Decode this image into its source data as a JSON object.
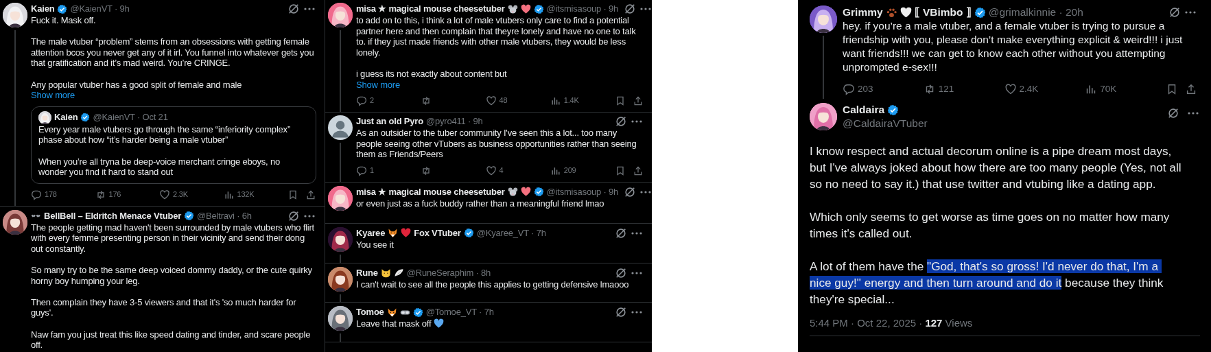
{
  "left_column": {
    "posts": [
      {
        "avatar": {
          "kind": "picture"
        },
        "name_parts": [
          {
            "kind": "text",
            "text": "Kaien"
          }
        ],
        "verified": true,
        "meta": "@KaienVT · 9h",
        "thread": true,
        "paragraphs": [
          "Fuck it. Mask off.",
          "The male vtuber “problem” stems from an obsessions with getting female attention bcos you never get any of it irl. You funnel into whatever gets you that gratification and it’s mad weird. You’re CRINGE.",
          "Any popular vtuber has a good split of female and male"
        ],
        "show_more": "Show more",
        "quote": {
          "avatar": {
            "kind": "picture"
          },
          "name": "Kaien",
          "verified": true,
          "meta": "@KaienVT · Oct 21",
          "paragraphs": [
            "Every year male vtubers go through the same “inferiority complex” phase about how “it’s harder being a male vtuber”",
            "When you’re all tryna be deep-voice merchant cringe eboys, no wonder you find it hard to stand out"
          ]
        },
        "stats": {
          "replies": "178",
          "reposts": "176",
          "likes": "2.3K",
          "views": "132K"
        }
      },
      {
        "avatar": {
          "kind": "picture"
        },
        "name_parts": [
          {
            "kind": "bats"
          },
          {
            "kind": "text",
            "text": "BellBell – Eldritch Menace Vtuber"
          }
        ],
        "verified": true,
        "meta": "@Beltravi · 6h",
        "thread": false,
        "paragraphs": [
          "The people getting mad haven't been surrounded by male vtubers who flirt with every femme presenting person in their vicinity and send their dong out constantly.",
          "So many try to be the same deep voiced dommy daddy, or the cute quirky horny boy humping your leg.",
          "Then complain they have 3-5 viewers and that it's 'so much harder for guys'.",
          "Naw fam you just treat this like speed dating and tinder, and scare people off."
        ]
      }
    ]
  },
  "middle_column": {
    "posts": [
      {
        "avatar": {
          "kind": "picture"
        },
        "name_parts": [
          {
            "kind": "text",
            "text": "misa ★ magical mouse cheesetuber"
          },
          {
            "kind": "mouse"
          },
          {
            "kind": "heart",
            "color": "#f4707f"
          }
        ],
        "verified": true,
        "meta": "@itsmisasoup · 9h",
        "thread": true,
        "paragraphs": [
          "to add on to this, i think a lot of male vtubers only care to find a potential partner here and then complain that theyre lonely and have no one to talk to. if they just made friends with other male vtubers, they would be less lonely.",
          "i guess its not exactly about content but"
        ],
        "show_more": "Show more",
        "stats": {
          "replies": "2",
          "likes": "48",
          "views": "1.4K"
        }
      },
      {
        "avatar": {
          "kind": "default"
        },
        "name_parts": [
          {
            "kind": "text",
            "text": "Just an old Pyro"
          }
        ],
        "verified": false,
        "meta": "@pyro411 · 9h",
        "thread": true,
        "paragraphs": [
          "As an outsider to the tuber community I've seen this a lot... too many people seeing other vTubers as business opportunities rather than seeing them as Friends/Peers"
        ],
        "stats": {
          "replies": "1",
          "likes": "4",
          "views": "209"
        }
      },
      {
        "avatar": {
          "kind": "picture"
        },
        "name_parts": [
          {
            "kind": "text",
            "text": "misa ★ magical mouse cheesetuber"
          },
          {
            "kind": "mouse"
          },
          {
            "kind": "heart",
            "color": "#f4707f"
          }
        ],
        "verified": true,
        "meta": "@itsmisasoup · 9h",
        "thread": false,
        "paragraphs": [
          "or even just as a fuck buddy rather than a meaningful friend lmao"
        ]
      },
      {
        "avatar": {
          "kind": "picture"
        },
        "name_parts": [
          {
            "kind": "text",
            "text": "Kyaree"
          },
          {
            "kind": "fox"
          },
          {
            "kind": "heart",
            "color": "#e0243a"
          },
          {
            "kind": "text",
            "text": "Fox VTuber"
          }
        ],
        "verified": true,
        "meta": "@Kyaree_VT · 7h",
        "thread": true,
        "paragraphs": [
          "You see it"
        ]
      },
      {
        "avatar": {
          "kind": "picture"
        },
        "name_parts": [
          {
            "kind": "text",
            "text": "Rune"
          },
          {
            "kind": "cat"
          },
          {
            "kind": "wing"
          }
        ],
        "verified": false,
        "meta": "@RuneSeraphim · 8h",
        "thread": true,
        "paragraphs": [
          "I can't wait to see all the people this applies to getting defensive lmaooo"
        ]
      },
      {
        "avatar": {
          "kind": "picture"
        },
        "name_parts": [
          {
            "kind": "text",
            "text": "Tomoe"
          },
          {
            "kind": "fox"
          },
          {
            "kind": "goggles"
          }
        ],
        "verified": true,
        "meta": "@Tomoe_VT · 7h",
        "thread": true,
        "paragraphs": [
          {
            "parts": [
              {
                "kind": "text",
                "text": "Leave that mask off"
              },
              {
                "kind": "heart",
                "color": "#5aa8f0"
              }
            ]
          }
        ]
      }
    ]
  },
  "right_column": {
    "reply": {
      "avatar": {
        "kind": "picture"
      },
      "name_parts": [
        {
          "kind": "text",
          "text": "Grimmy"
        },
        {
          "kind": "paw"
        },
        {
          "kind": "heart",
          "color": "#f0f0f0"
        },
        {
          "kind": "text",
          "text": "⟦ VBimbo ⟧"
        }
      ],
      "verified": true,
      "meta": "@grimalkinnie · 20h",
      "thread": true,
      "paragraphs": [
        "hey. if you’re a male vtuber, and a female vtuber is trying to pursue a friendship with you, please don’t make everything explicit & weird!!! i just want friends!!! we can get to know each other without you attempting unprompted e-sex!!!"
      ],
      "stats": {
        "replies": "203",
        "reposts": "121",
        "likes": "2.4K",
        "views": "70K"
      }
    },
    "main_post": {
      "avatar": {
        "kind": "picture"
      },
      "name": "Caldaira",
      "verified": true,
      "handle": "@CaldairaVTuber",
      "paragraphs": [
        {
          "parts": [
            {
              "kind": "text",
              "text": "I know respect and actual decorum online is a pipe dream most days, but I've always joked about how there are too many people (Yes, not all so no need to say it.) that use twitter and vtubing like a dating app.",
              "highlighted": false
            }
          ]
        },
        {
          "parts": [
            {
              "kind": "text",
              "text": "Which only seems to get worse as time goes on no matter how many times it's called out.",
              "highlighted": false
            }
          ]
        },
        {
          "parts": [
            {
              "kind": "text",
              "text": "A lot of them have the ",
              "highlighted": false
            },
            {
              "kind": "text",
              "text": "\"God, that's so gross! I'd never do that, I'm a nice guy!\" energy and then turn around and do it",
              "highlighted": true
            },
            {
              "kind": "text",
              "text": " because they think they're special...",
              "highlighted": false
            }
          ]
        }
      ],
      "footer": "5:44 PM · Oct 22, 2025 · **127** Views"
    }
  }
}
